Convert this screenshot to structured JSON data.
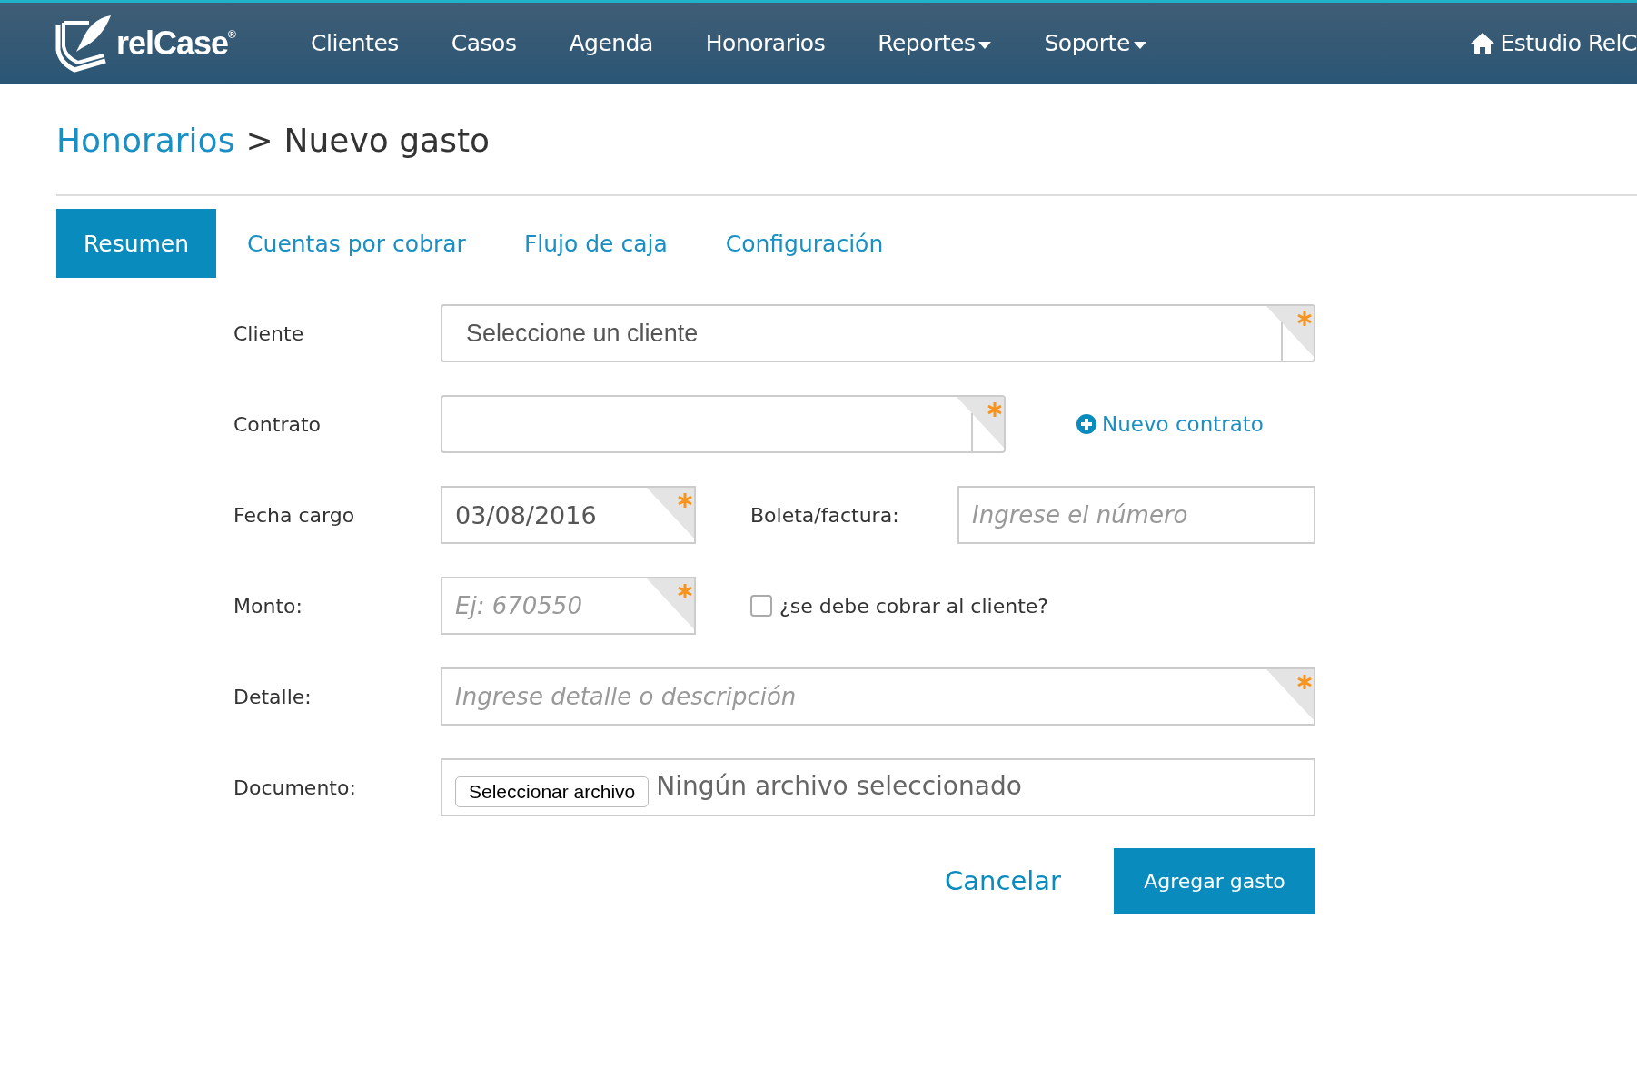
{
  "header": {
    "logo": {
      "text": "relCase",
      "mark": "®"
    },
    "nav": [
      {
        "label": "Clientes",
        "dropdown": false
      },
      {
        "label": "Casos",
        "dropdown": false
      },
      {
        "label": "Agenda",
        "dropdown": false
      },
      {
        "label": "Honorarios",
        "dropdown": false
      },
      {
        "label": "Reportes",
        "dropdown": true
      },
      {
        "label": "Soporte",
        "dropdown": true
      }
    ],
    "account": "Estudio RelC"
  },
  "breadcrumb": {
    "parent": "Honorarios",
    "separator": ">",
    "current": "Nuevo gasto"
  },
  "tabs": [
    {
      "label": "Resumen",
      "selected": true
    },
    {
      "label": "Cuentas por cobrar",
      "selected": false
    },
    {
      "label": "Flujo de caja",
      "selected": false
    },
    {
      "label": "Configuración",
      "selected": false
    }
  ],
  "form": [
    {
      "label": "Cliente",
      "field": {
        "kind": "select",
        "value": "Seleccione un cliente",
        "required": true
      }
    },
    {
      "label": "Contrato",
      "field": {
        "kind": "select",
        "required": true
      },
      "aside": {
        "kind": "link",
        "text": "Nuevo contrato"
      }
    },
    {
      "label": "Fecha cargo",
      "field": {
        "kind": "text",
        "value": "03/08/2016",
        "required": true
      },
      "aside": {
        "kind": "field",
        "label": "Boleta/factura:",
        "placeholder": "Ingrese el número"
      }
    },
    {
      "label": "Monto:",
      "field": {
        "kind": "text",
        "placeholder": "Ej: 670550",
        "required": true
      },
      "aside": {
        "kind": "checkbox",
        "label": "¿se debe cobrar al cliente?",
        "checked": false
      }
    },
    {
      "label": "Detalle:",
      "field": {
        "kind": "text",
        "placeholder": "Ingrese detalle o descripción",
        "required": true
      }
    },
    {
      "label": "Documento:",
      "field": {
        "kind": "file",
        "button": "Seleccionar archivo",
        "status": "Ningún archivo seleccionado"
      }
    }
  ],
  "actions": {
    "cancel": "Cancelar",
    "submit": "Agregar gasto"
  }
}
